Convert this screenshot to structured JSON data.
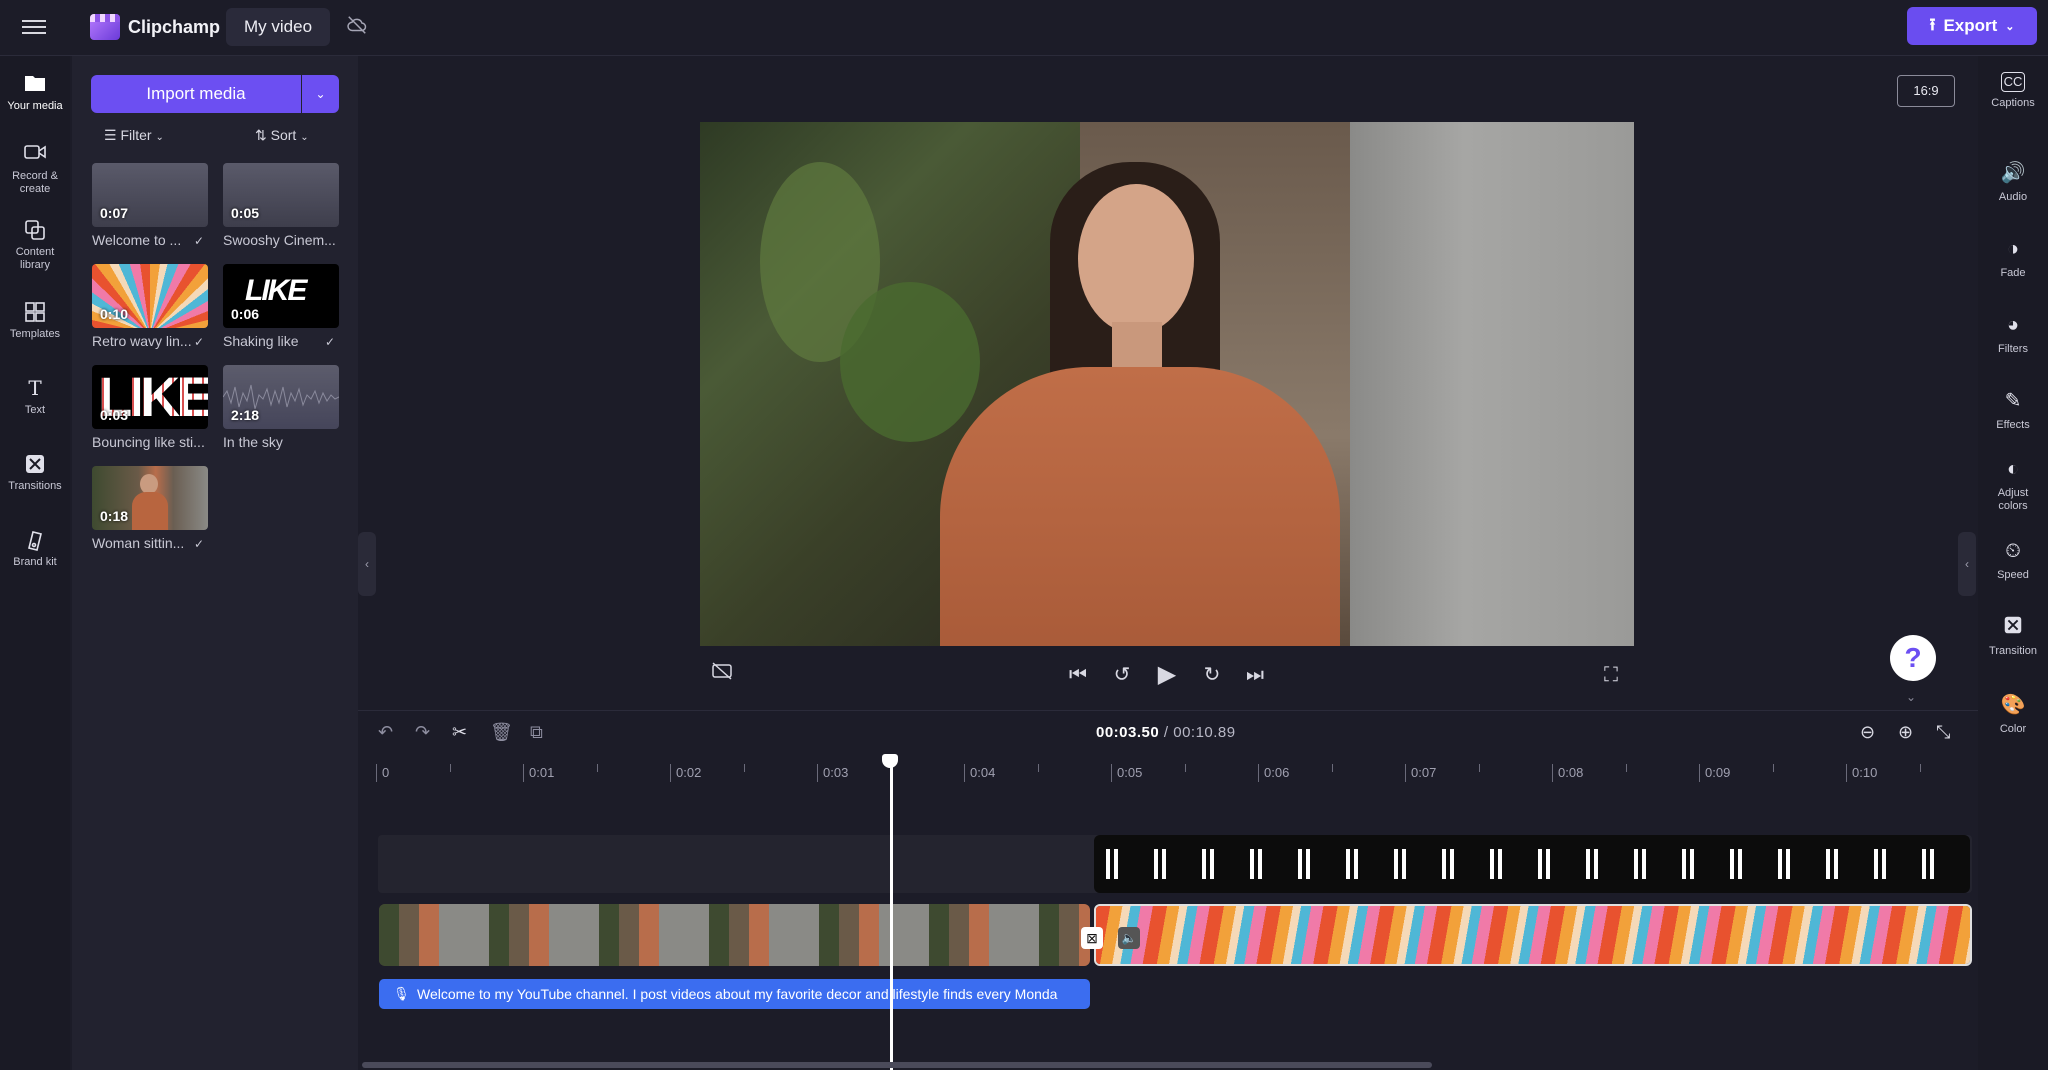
{
  "topbar": {
    "app_name": "Clipchamp",
    "project_name": "My video",
    "export_label": "Export"
  },
  "leftnav": {
    "items": [
      {
        "label": "Your media"
      },
      {
        "label": "Record &",
        "label2": "create"
      },
      {
        "label": "Content",
        "label2": "library"
      },
      {
        "label": "Templates"
      },
      {
        "label": "Text"
      },
      {
        "label": "Transitions"
      },
      {
        "label": "Brand kit"
      }
    ]
  },
  "media": {
    "import_label": "Import media",
    "filter_label": "Filter",
    "sort_label": "Sort",
    "items": [
      {
        "duration": "0:07",
        "label": "Welcome to ...",
        "checked": true
      },
      {
        "duration": "0:05",
        "label": "Swooshy Cinem...",
        "checked": false
      },
      {
        "duration": "0:10",
        "label": "Retro wavy lin...",
        "checked": true
      },
      {
        "duration": "0:06",
        "label": "Shaking like",
        "checked": true
      },
      {
        "duration": "0:03",
        "label": "Bouncing like sti...",
        "checked": false
      },
      {
        "duration": "2:18",
        "label": "In the sky",
        "checked": false
      },
      {
        "duration": "0:18",
        "label": "Woman sittin...",
        "checked": true
      }
    ]
  },
  "preview": {
    "aspect_ratio": "16:9"
  },
  "rightnav": {
    "items": [
      {
        "label": "Captions"
      },
      {
        "label": "Audio"
      },
      {
        "label": "Fade"
      },
      {
        "label": "Filters"
      },
      {
        "label": "Effects"
      },
      {
        "label": "Adjust",
        "label2": "colors"
      },
      {
        "label": "Speed"
      },
      {
        "label": "Transition"
      },
      {
        "label": "Color"
      }
    ]
  },
  "timeline": {
    "current_time": "00:03.50",
    "total_time": "/ 00:10.89",
    "ruler": [
      "0",
      "0:01",
      "0:02",
      "0:03",
      "0:04",
      "0:05",
      "0:06",
      "0:07",
      "0:08",
      "0:09",
      "0:10"
    ],
    "caption_text": "Welcome to my YouTube channel. I post videos about my favorite decor and lifestyle finds every Monda"
  },
  "colors": {
    "accent": "#6c4ff2",
    "caption_clip": "#3b6df0",
    "background": "#1c1c28"
  }
}
